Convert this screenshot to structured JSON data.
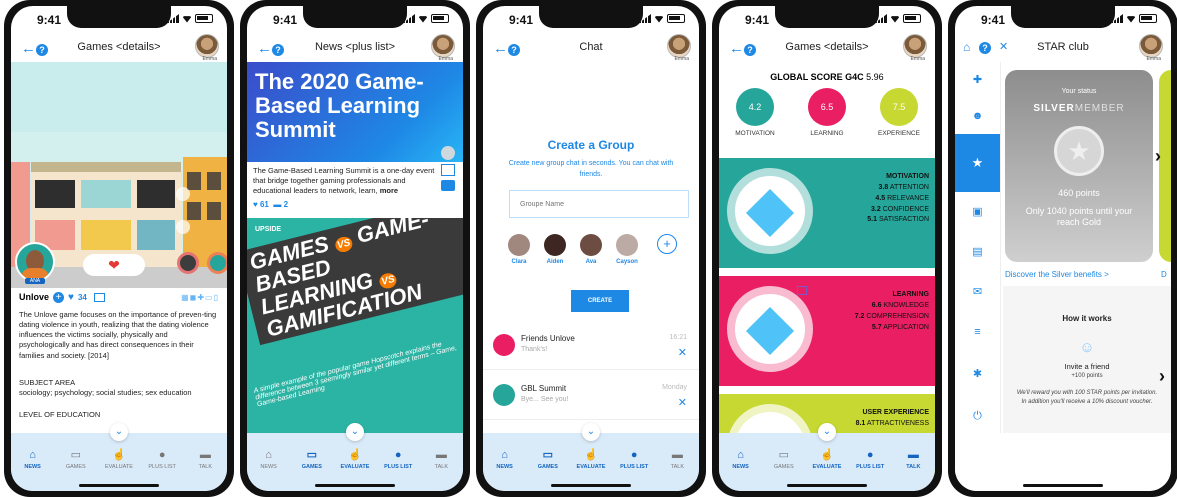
{
  "status": {
    "time": "9:41"
  },
  "tabbar": {
    "news": "NEWS",
    "games": "GAMES",
    "evaluate": "EVALUATE",
    "plus_list": "PLUS LIST",
    "talk": "TALK"
  },
  "screen1": {
    "title": "Games <details>",
    "avatar_name": "Emma",
    "game_name": "Unlove",
    "likes": "34",
    "badge_label": "ANA",
    "description": "The Unlove game focuses on the importance of preven-ting dating violence in youth, realizing that the dating violence influences the victims socially, physically and psychologically and has direct consequences in their families and society. [2014]",
    "subject_area_label": "SUBJECT AREA",
    "subject_area_value": "sociology; psychology; social studies; sex education",
    "level_label": "LEVEL OF EDUCATION"
  },
  "screen2": {
    "title": "News <plus list>",
    "avatar_name": "Emma",
    "banner_title": "The 2020 Game-Based Learning Summit",
    "body": "The Game-Based Learning Summit is a one-day event that bridge together gaming professionals and educational leaders to network, learn,",
    "more": "more",
    "likes": "61",
    "comments": "2",
    "poster_brand": "UPSIDE",
    "poster_line1": "GAMES",
    "poster_vs1": "VS",
    "poster_line2": "GAME-BASED",
    "poster_line3": "LEARNING",
    "poster_vs2": "VS",
    "poster_line4": "GAMIFICATION",
    "poster_caption": "A simple example of the popular game Hopscotch explains the difference between 3 seemingly similar yet different terms – Game, Game-based Learning"
  },
  "screen3": {
    "title": "Chat",
    "avatar_name": "Emma",
    "heading": "Create a Group",
    "subtitle": "Create new group chat in seconds. You can chat with friends.",
    "input_placeholder": "Groupe Name",
    "friends": [
      "Clara",
      "Aiden",
      "Ava",
      "Cayson"
    ],
    "create_label": "CREATE",
    "chats": [
      {
        "name": "Friends Unlove",
        "time": "16:21",
        "preview": "Thank's!"
      },
      {
        "name": "GBL Summit",
        "time": "Monday",
        "preview": "Bye... See you!"
      }
    ]
  },
  "screen4": {
    "title": "Games <details>",
    "avatar_name": "Emma",
    "global_label": "GLOBAL SCORE G4C",
    "global_value": "5.96",
    "scores": [
      {
        "value": "4.2",
        "label": "MOTIVATION",
        "color": "#26a69a"
      },
      {
        "value": "6.5",
        "label": "LEARNING",
        "color": "#e91e63"
      },
      {
        "value": "7.5",
        "label": "EXPERIENCE",
        "color": "#c6d831"
      }
    ],
    "sections": [
      {
        "title": "MOTIVATION",
        "color": "#26a69a",
        "items": [
          [
            "3.8",
            "ATTENTION"
          ],
          [
            "4.5",
            "RELEVANCE"
          ],
          [
            "3.2",
            "CONFIDENCE"
          ],
          [
            "5.1",
            "SATISFACTION"
          ]
        ]
      },
      {
        "title": "LEARNING",
        "color": "#e91e63",
        "items": [
          [
            "6.6",
            "KNOWLEDGE"
          ],
          [
            "7.2",
            "COMPREHENSION"
          ],
          [
            "5.7",
            "APPLICATION"
          ]
        ]
      },
      {
        "title": "USER EXPERIENCE",
        "color": "#c6d831",
        "items": [
          [
            "8.1",
            "ATTRACTIVENESS"
          ]
        ]
      }
    ]
  },
  "screen5": {
    "title": "STAR club",
    "avatar_name": "Emma",
    "your_status": "Your status",
    "member_level": "SILVER",
    "member_suffix": "MEMBER",
    "points": "460 points",
    "until_gold": "Only 1040 points until your reach Gold",
    "discover": "Discover the Silver benefits >",
    "discover_next": "D",
    "how_it_works": "How it works",
    "invite_title": "Invite a friend",
    "invite_points": "+100 points",
    "invite_desc": "We'll reward you with 100 STAR points per invitation. In addition you'll receive a 10% discount voucher."
  }
}
